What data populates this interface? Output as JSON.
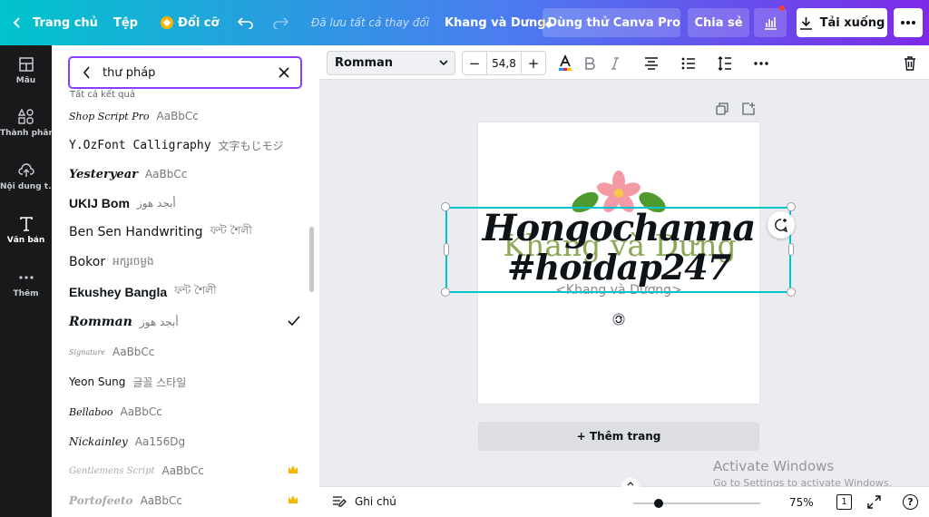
{
  "topbar": {
    "home_label": "Trang chủ",
    "file_label": "Tệp",
    "resize_label": "Đổi cỡ",
    "saved_status": "Đã lưu tất cả thay đổi",
    "design_title": "Khang và Dưng",
    "pro_label": "Dùng thử Canva Pro",
    "share_label": "Chia sẻ",
    "download_label": "Tải xuống",
    "brand_gradient": [
      "#00c4cc",
      "#4c7bf0",
      "#7d2ae8"
    ]
  },
  "rail": {
    "items": [
      {
        "label": "Mẫu",
        "icon": "layout-icon"
      },
      {
        "label": "Thành phần",
        "icon": "elements-icon"
      },
      {
        "label": "Nội dung t...",
        "icon": "upload-icon"
      },
      {
        "label": "Văn bản",
        "icon": "text-icon"
      },
      {
        "label": "Thêm",
        "icon": "more-icon"
      }
    ]
  },
  "panel": {
    "search_value": "thư pháp",
    "results_label": "Tất cả kết quả",
    "fonts": [
      {
        "name": "Shop Script Pro",
        "sample": "AaBbCc",
        "selected": false,
        "pro": false
      },
      {
        "name": "Y.OzFont Calligraphy",
        "sample": "文字もじモジ",
        "selected": false,
        "pro": false
      },
      {
        "name": "Yesteryear",
        "sample": "AaBbCc",
        "selected": false,
        "pro": false
      },
      {
        "name": "UKIJ Bom",
        "sample": "أبجد هوز",
        "selected": false,
        "pro": false
      },
      {
        "name": "Ben Sen Handwriting",
        "sample": "ফন্ট শৈলী",
        "selected": false,
        "pro": false
      },
      {
        "name": "Bokor",
        "sample": "អក្សរចម្លង",
        "selected": false,
        "pro": false
      },
      {
        "name": "Ekushey Bangla",
        "sample": "ফন্ট শৈলী",
        "selected": false,
        "pro": false
      },
      {
        "name": "Romman",
        "sample": "أبجد هوز",
        "selected": true,
        "pro": false
      },
      {
        "name": "Signature",
        "sample": "AaBbCc",
        "selected": false,
        "pro": false
      },
      {
        "name": "Yeon Sung",
        "sample": "글꼴 스타일",
        "selected": false,
        "pro": false
      },
      {
        "name": "Bellaboo",
        "sample": "AaBbCc",
        "selected": false,
        "pro": false
      },
      {
        "name": "Nickainley",
        "sample": "Aa156Dg",
        "selected": false,
        "pro": false
      },
      {
        "name": "Gentlemens Script",
        "sample": "AaBbCc",
        "selected": false,
        "pro": true
      },
      {
        "name": "Portofeeto",
        "sample": "AaBbCc",
        "selected": false,
        "pro": true
      }
    ]
  },
  "toolbar": {
    "font_name": "Romman",
    "font_size": "54,8",
    "minus": "−",
    "plus": "+",
    "text_color": "#e91e63"
  },
  "canvas": {
    "ghost_text": "Khang và Dưng",
    "line1": "Hongochanna",
    "line2": "#hoidap247",
    "sub_text": "<Khang và Dương>",
    "add_page_label": "+ Thêm trang"
  },
  "bottombar": {
    "notes_label": "Ghi chú",
    "zoom_label": "75%",
    "page_count": "1",
    "zoom_fraction": 0.2
  },
  "watermark": {
    "title": "Activate Windows",
    "subtitle": "Go to Settings to activate Windows."
  }
}
